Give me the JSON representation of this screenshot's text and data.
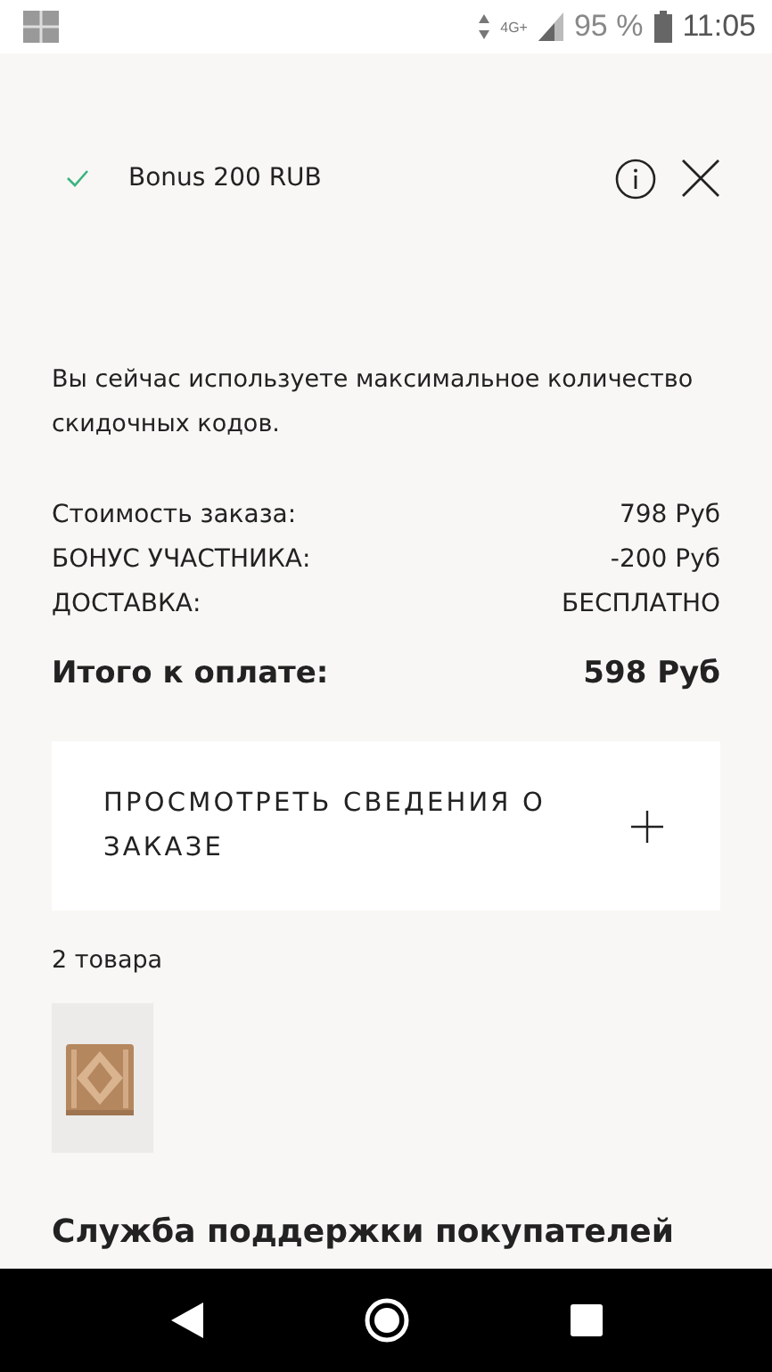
{
  "status_bar": {
    "network": "4G+",
    "battery": "95 %",
    "time": "11:05"
  },
  "coupon": {
    "applied": true,
    "label": "Bonus 200 RUB"
  },
  "notice": "Вы сейчас используете максимальное количество скидочных кодов.",
  "summary": [
    {
      "label": "Стоимость заказа:",
      "value": "798 Руб"
    },
    {
      "label": "БОНУС УЧАСТНИКА:",
      "value": "-200 Руб"
    },
    {
      "label": "ДОСТАВКА:",
      "value": "БЕСПЛАТНО"
    }
  ],
  "total": {
    "label": "Итого к оплате:",
    "value": "598 Руб"
  },
  "details": {
    "label": "ПРОСМОТРЕТЬ СВЕДЕНИЯ О ЗАКАЗЕ",
    "expanded": false
  },
  "items_count": "2 товара",
  "support_heading": "Служба поддержки покупателей"
}
